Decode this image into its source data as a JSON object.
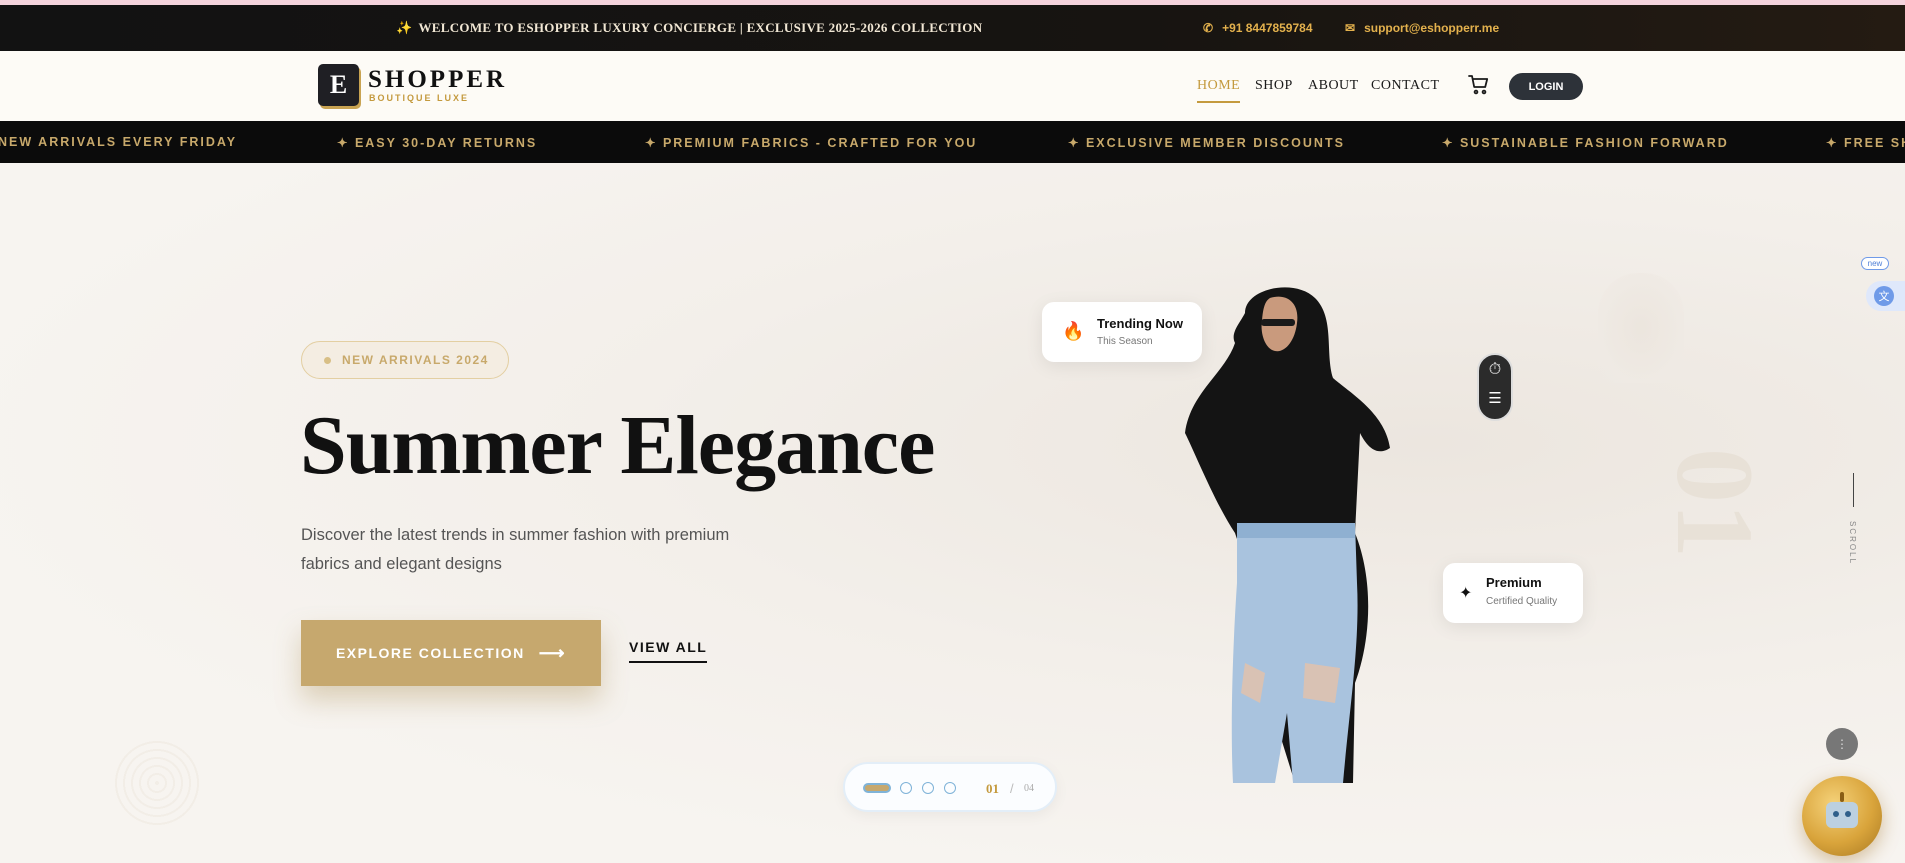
{
  "topbar": {
    "welcome": "WELCOME TO ESHOPPER LUXURY CONCIERGE | EXCLUSIVE 2025-2026 COLLECTION",
    "phone": "+91 8447859784",
    "email": "support@eshopperr.me"
  },
  "header": {
    "logo_letter": "E",
    "logo_text": "SHOPPER",
    "logo_subtitle": "BOUTIQUE LUXE",
    "nav": [
      "HOME",
      "SHOP",
      "ABOUT",
      "CONTACT"
    ],
    "active_nav": "HOME",
    "login_label": "LOGIN"
  },
  "ticker": [
    "NEW ARRIVALS EVERY FRIDAY",
    "✦ EASY 30-DAY RETURNS",
    "✦ PREMIUM FABRICS - CRAFTED FOR YOU",
    "✦ EXCLUSIVE MEMBER DISCOUNTS",
    "✦ SUSTAINABLE FASHION FORWARD",
    "✦ FREE SH"
  ],
  "hero": {
    "badge": "NEW ARRIVALS 2024",
    "title": "Summer Elegance",
    "subtitle": "Discover the latest trends in summer fashion with premium fabrics and elegant designs",
    "primary_cta": "EXPLORE COLLECTION",
    "secondary_cta": "VIEW ALL",
    "slide_number": "01",
    "slide_separator": "/",
    "slide_total": "04",
    "scroll_label": "SCROLL",
    "big_number": "01",
    "active_slide": 1,
    "slide_count": 4
  },
  "cards": {
    "trending_title": "Trending Now",
    "trending_sub": "This Season",
    "premium_title": "Premium",
    "premium_sub": "Certified Quality"
  },
  "extension": {
    "new_tag": "new"
  },
  "icons": {
    "topbar_sparkle": "sparkle-icon",
    "phone": "phone-icon",
    "email": "mail-icon",
    "cart": "cart-icon",
    "trending": "flame-icon",
    "premium": "star-icon",
    "arrow": "arrow-right-icon"
  },
  "colors": {
    "accent_gold": "#c6a86e",
    "topbar_bg": "#121212",
    "login_bg": "#2d3239",
    "ticker_text": "#c8a96b"
  }
}
